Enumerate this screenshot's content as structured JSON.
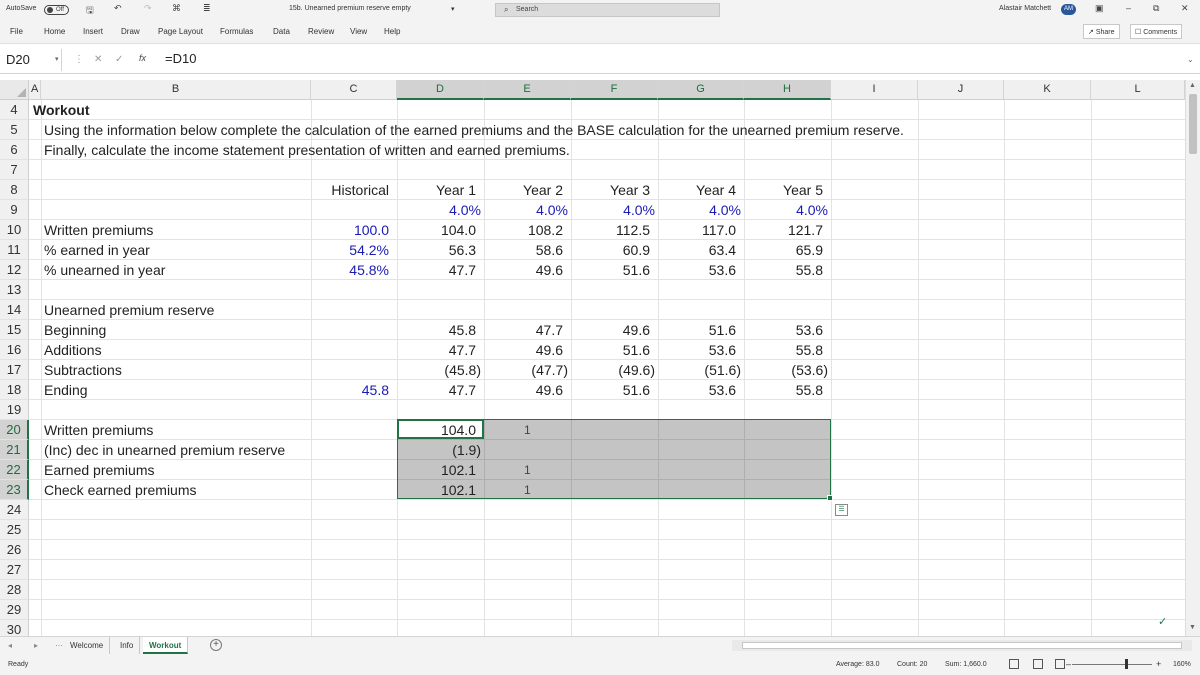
{
  "titlebar": {
    "autosave_label": "AutoSave",
    "autosave_state": "Off",
    "doc_title": "15b. Unearned premium reserve empty",
    "search_placeholder": "Search",
    "user_name": "Alastair Matchett",
    "user_initials": "AM"
  },
  "ribbon": {
    "tabs": [
      "File",
      "Home",
      "Insert",
      "Draw",
      "Page Layout",
      "Formulas",
      "Data",
      "Review",
      "View",
      "Help"
    ],
    "share_label": "Share",
    "comments_label": "Comments"
  },
  "formula_bar": {
    "name_box": "D20",
    "fx": "fx",
    "formula": "=D10"
  },
  "columns": [
    "A",
    "B",
    "C",
    "D",
    "E",
    "F",
    "G",
    "H",
    "I",
    "J",
    "K",
    "L"
  ],
  "rows": [
    "4",
    "5",
    "6",
    "7",
    "8",
    "9",
    "10",
    "11",
    "12",
    "13",
    "14",
    "15",
    "16",
    "17",
    "18",
    "19",
    "20",
    "21",
    "22",
    "23",
    "24",
    "25",
    "26",
    "27",
    "28",
    "29",
    "30"
  ],
  "sheet": {
    "title": "Workout",
    "instruction1": "Using the information below complete the calculation of the earned premiums and the BASE calculation for the unearned premium reserve.",
    "instruction2": "Finally, calculate the income statement presentation of written and earned premiums.",
    "headers": [
      "Historical",
      "Year 1",
      "Year 2",
      "Year 3",
      "Year 4",
      "Year 5"
    ],
    "growth": [
      "4.0%",
      "4.0%",
      "4.0%",
      "4.0%",
      "4.0%"
    ],
    "written": {
      "label": "Written premiums",
      "values": [
        "100.0",
        "104.0",
        "108.2",
        "112.5",
        "117.0",
        "121.7"
      ]
    },
    "pct_earned": {
      "label": "% earned in year",
      "values": [
        "54.2%",
        "56.3",
        "58.6",
        "60.9",
        "63.4",
        "65.9"
      ]
    },
    "pct_unearned": {
      "label": "% unearned in year",
      "values": [
        "45.8%",
        "47.7",
        "49.6",
        "51.6",
        "53.6",
        "55.8"
      ]
    },
    "upr_title": "Unearned premium reserve",
    "beginning": {
      "label": "Beginning",
      "values": [
        "45.8",
        "47.7",
        "49.6",
        "51.6",
        "53.6"
      ]
    },
    "additions": {
      "label": "Additions",
      "values": [
        "47.7",
        "49.6",
        "51.6",
        "53.6",
        "55.8"
      ]
    },
    "subtractions": {
      "label": "Subtractions",
      "values": [
        "(45.8)",
        "(47.7)",
        "(49.6)",
        "(51.6)",
        "(53.6)"
      ]
    },
    "ending": {
      "label": "Ending",
      "values": [
        "45.8",
        "47.7",
        "49.6",
        "51.6",
        "53.6",
        "55.8"
      ]
    },
    "is_written": {
      "label": "Written premiums",
      "value": "104.0",
      "marker": "1"
    },
    "is_change": {
      "label": "(Inc) dec in unearned premium reserve",
      "value": "(1.9)"
    },
    "is_earned": {
      "label": "Earned premiums",
      "value": "102.1",
      "marker": "1"
    },
    "is_check": {
      "label": "Check earned premiums",
      "value": "102.1",
      "marker": "1"
    }
  },
  "sheet_tabs": [
    "Welcome",
    "Info",
    "Workout"
  ],
  "active_sheet": "Workout",
  "statusbar": {
    "ready": "Ready",
    "average": "Average: 83.0",
    "count": "Count: 20",
    "sum": "Sum: 1,660.0",
    "zoom": "160%"
  },
  "colors": {
    "accent": "#217346",
    "input_blue": "#1a1ab8",
    "profile": "#2b579a"
  }
}
